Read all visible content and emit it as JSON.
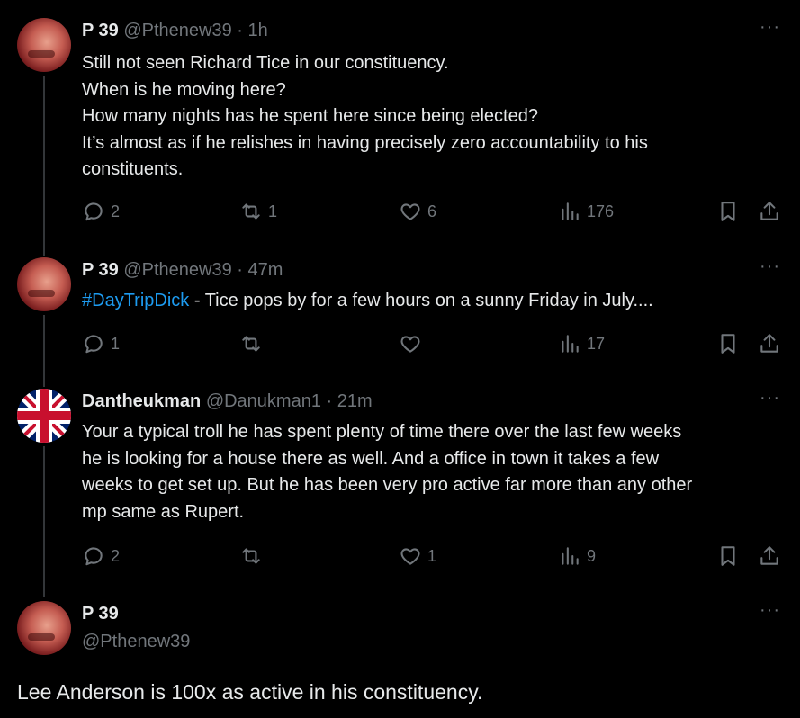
{
  "tweets": [
    {
      "name": "P 39",
      "handle": "@Pthenew39",
      "dot": "·",
      "time": "1h",
      "avatar_icon": "profile-photo-red-face",
      "lines": [
        "Still not seen Richard Tice in our constituency.",
        "When is he moving here?",
        "How many nights has he spent here since being elected?",
        "It’s almost as if he relishes in having precisely zero accountability to his",
        "constituents."
      ],
      "replies": "2",
      "retweets": "1",
      "likes": "6",
      "views": "176"
    },
    {
      "name": "P 39",
      "handle": "@Pthenew39",
      "dot": "·",
      "time": "47m",
      "avatar_icon": "profile-photo-red-face",
      "hashtag": "#DayTripDick",
      "text_after_hashtag": " - Tice pops by for a few hours on a sunny Friday in July....",
      "replies": "1",
      "retweets": "",
      "likes": "",
      "views": "17"
    },
    {
      "name": "Dantheukman",
      "handle": "@Danukman1",
      "dot": "·",
      "time": "21m",
      "avatar_icon": "union-jack-flag",
      "lines": [
        "Your a typical troll he has spent plenty of time there over the last few weeks",
        "he is looking for a house there as well. And a office in town it takes a few",
        "weeks to get set up. But he has been very pro active far more than any other",
        "mp same as Rupert."
      ],
      "replies": "2",
      "retweets": "",
      "likes": "1",
      "views": "9"
    }
  ],
  "main_tweet": {
    "name": "P 39",
    "handle": "@Pthenew39",
    "avatar_icon": "profile-photo-red-face",
    "text": "Lee Anderson is 100x as active in his constituency."
  },
  "more_label": "···",
  "colors": {
    "background": "#000000",
    "text": "#e7e9ea",
    "muted": "#71767b",
    "link": "#1d9bf0",
    "thread_line": "#333639"
  }
}
